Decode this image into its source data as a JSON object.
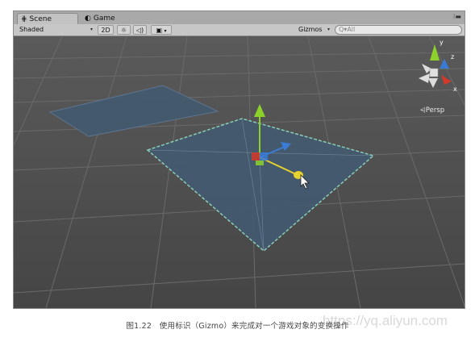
{
  "tabs": [
    {
      "label": "Scene",
      "icon": "scene-icon"
    },
    {
      "label": "Game",
      "icon": "game-icon"
    }
  ],
  "toolbar": {
    "shading_mode": "Shaded",
    "mode_2d": "2D",
    "lighting_icon": "sun-icon",
    "audio_icon": "speaker-icon",
    "effects_icon": "image-icon",
    "gizmos_label": "Gizmos",
    "search_placeholder": "Q▾All"
  },
  "view_gizmo": {
    "axis_y": "y",
    "axis_z": "z",
    "axis_x": "x",
    "projection_label": "⩤Persp"
  },
  "caption": "图1.22　使用标识（Gizmo）来完成对一个游戏对象的变换操作",
  "watermark": "https://yq.aliyun.com",
  "colors": {
    "viewport_bg": "#4d4d4d",
    "grid_line": "#6a6a6a",
    "plane_fill": "#445a70",
    "selection_outline": "#8ed8c0",
    "axis_x": "#d33a2a",
    "axis_y": "#8cd22a",
    "axis_z": "#3a7bd5",
    "move_handle": "#e6d22e"
  }
}
